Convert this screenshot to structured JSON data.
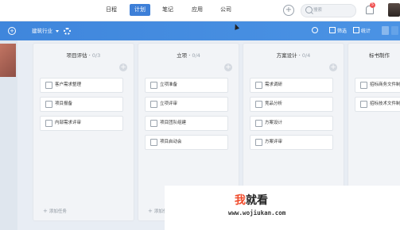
{
  "topnav": {
    "tabs": [
      {
        "label": "日程"
      },
      {
        "label": "计划"
      },
      {
        "label": "笔记"
      },
      {
        "label": "应用"
      },
      {
        "label": "公司"
      }
    ],
    "active_tab": "计划",
    "search_placeholder": "搜索",
    "notification_count": "5"
  },
  "toolbar": {
    "project_selector": "建筑行业",
    "filter_label": "筛选",
    "stats_label": "统计"
  },
  "columns": [
    {
      "title": "项目评估",
      "count": "0/3",
      "cards": [
        "客户需求整理",
        "项目报备",
        "内部需求评审"
      ],
      "add_label": "添加任务"
    },
    {
      "title": "立项",
      "count": "0/4",
      "cards": [
        "立项准备",
        "立项评审",
        "项目团队组建",
        "项目启动会"
      ],
      "add_label": "添加任务"
    },
    {
      "title": "方案设计",
      "count": "0/4",
      "cards": [
        "需求调研",
        "竞品分析",
        "方案设计",
        "方案评审"
      ],
      "add_label": ""
    },
    {
      "title": "标书制作",
      "count": "",
      "cards": [
        "招标商务文件制",
        "招标技术文件制"
      ],
      "add_label": ""
    }
  ],
  "watermark": {
    "logo_accent": "我",
    "logo_rest": "就看",
    "url": "www.wojiukan.com"
  },
  "colors": {
    "accent": "#3d7fd8",
    "band": "#4b93e4",
    "badge": "#f05454"
  }
}
